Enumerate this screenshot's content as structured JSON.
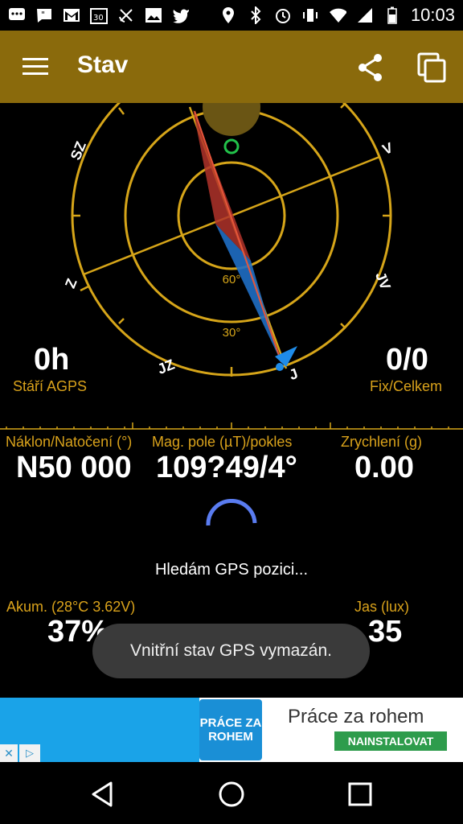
{
  "status_bar": {
    "time": "10:03",
    "left_icons": [
      "message-icon",
      "chat-icon",
      "gmail-icon",
      "calendar-30-icon",
      "satellite-off-icon",
      "image-icon",
      "twitter-icon"
    ],
    "right_icons": [
      "location-icon",
      "bluetooth-icon",
      "alarm-icon",
      "vibrate-icon",
      "wifi-icon",
      "signal-icon",
      "battery-icon"
    ]
  },
  "app_bar": {
    "title": "Stav",
    "menu_icon": "hamburger-icon",
    "share_icon": "share-icon",
    "copy_icon": "copy-icon"
  },
  "radar": {
    "directions": [
      "SZ",
      "V",
      "Z",
      "JV",
      "JZ",
      "J"
    ],
    "rings": [
      "60°",
      "30°"
    ]
  },
  "gps_age": {
    "value": "0h",
    "label": "Stáří AGPS"
  },
  "fix": {
    "value": "0/0",
    "label": "Fix/Celkem"
  },
  "sensors": {
    "tilt_label": "Náklon/Natočení (°)",
    "tilt_value": "N50 000",
    "mag_label": "Mag. pole (µT)/pokles",
    "mag_value": "109?49/4°",
    "accel_label": "Zrychlení (g)",
    "accel_value": "0.00"
  },
  "search_text": "Hledám GPS pozici...",
  "battery": {
    "label": "Akum. (28°C 3.62V)",
    "value": "37%"
  },
  "brightness": {
    "label": "Jas (lux)",
    "value": "35"
  },
  "toast": "Vnitřní stav GPS vymazán.",
  "ad": {
    "logo_text": "PRÁCE ZA ROHEM",
    "title": "Práce za rohem",
    "install_label": "NAINSTALOVAT"
  },
  "nav": [
    "back-icon",
    "home-icon",
    "recents-icon"
  ]
}
